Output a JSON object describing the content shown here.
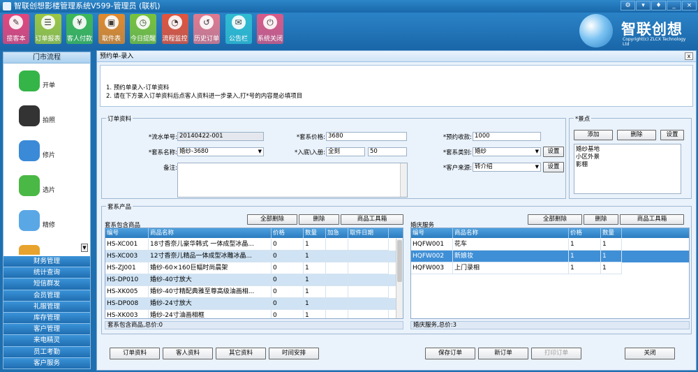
{
  "window": {
    "title": "智联创想影楼管理系统V599-管理员 (联机)"
  },
  "toolbar": [
    {
      "label": "揽客本",
      "color": "#e3457b"
    },
    {
      "label": "订单报表",
      "color": "#9bc742"
    },
    {
      "label": "客人付款",
      "color": "#3db858"
    },
    {
      "label": "取件表",
      "color": "#e28a2a"
    },
    {
      "label": "今日提醒",
      "color": "#78c23c"
    },
    {
      "label": "流程监控",
      "color": "#e2543c"
    },
    {
      "label": "历史订单",
      "color": "#e07a8e"
    },
    {
      "label": "公告栏",
      "color": "#2fbcd2"
    },
    {
      "label": "系统关闭",
      "color": "#d95a87"
    }
  ],
  "logo": {
    "name": "智联创想",
    "sub": "Copyright(c) ZLCX Technology Ltd"
  },
  "sidebar": {
    "title": "门市流程",
    "items": [
      {
        "label": "开单",
        "color": "#35b548"
      },
      {
        "label": "拍照",
        "color": "#333333"
      },
      {
        "label": "修片",
        "color": "#3a8ad8"
      },
      {
        "label": "选片",
        "color": "#4ab844"
      },
      {
        "label": "精修",
        "color": "#5aa7e6"
      }
    ],
    "menu": [
      "财务管理",
      "统计查询",
      "短信群发",
      "会员管理",
      "礼服管理",
      "库存管理",
      "客户管理",
      "来电精灵",
      "员工考勤",
      "客户服务"
    ]
  },
  "panel": {
    "title": "预约单-录入",
    "close": "x",
    "notes": [
      "1. 预约单录入-订单资料",
      "2. 请在下方录入订单资料后点客人资料进一步录入,打*号的内容是必填项目"
    ]
  },
  "order": {
    "group_label": "订单资料",
    "serial_label": "*流水单号:",
    "serial_value": "20140422-001",
    "package_name_label": "*套系名称:",
    "package_name_value": "婚纱-3680",
    "notes_label": "备注:",
    "price_label": "*套系价格:",
    "price_value": "3680",
    "base_label": "*入底\\入册:",
    "base_value": "全刻",
    "album_value": "50",
    "deposit_label": "*预约收款:",
    "deposit_value": "1000",
    "type_label": "*套系类别:",
    "type_value": "婚纱",
    "source_label": "*客户来源:",
    "source_value": "转介绍",
    "settings_label": "设置"
  },
  "scenes": {
    "group_label": "*景点",
    "add": "添加",
    "delete": "删除",
    "settings": "设置",
    "items": [
      "婚纱基地",
      "小区外景",
      "影棚"
    ]
  },
  "products": {
    "group_label": "套系产品",
    "left_title": "套系包含商品",
    "left_buttons": [
      "全部删除",
      "删除",
      "商品工具箱"
    ],
    "left_columns": [
      "编号",
      "商品名称",
      "价格",
      "数量",
      "加急",
      "取件日期"
    ],
    "left_rows": [
      [
        "HS-XC001",
        "18寸香奈儿豪华韩式 一体成型冰晶...",
        "0",
        "1",
        "",
        ""
      ],
      [
        "HS-XC003",
        "12寸香奈儿精品一体成型冰雕冰晶...",
        "0",
        "1",
        "",
        ""
      ],
      [
        "HS-ZJ001",
        "婚纱-60×160巨幅时尚晨架",
        "0",
        "1",
        "",
        ""
      ],
      [
        "HS-DP010",
        "婚纱-40寸放大",
        "0",
        "1",
        "",
        ""
      ],
      [
        "HS-XK005",
        "婚纱-40寸精配典雅至尊高级油画相...",
        "0",
        "1",
        "",
        ""
      ],
      [
        "HS-DP008",
        "婚纱-24寸放大",
        "0",
        "1",
        "",
        ""
      ],
      [
        "HS-XK003",
        "婚纱-24寸油画相框",
        "0",
        "1",
        "",
        ""
      ]
    ],
    "left_status": "套系包含商品,总价:0",
    "right_title": "婚庆服务",
    "right_buttons": [
      "全部删除",
      "删除",
      "商品工具箱"
    ],
    "right_columns": [
      "编号",
      "商品名称",
      "价格",
      "数量"
    ],
    "right_rows": [
      [
        "HQFW001",
        "花车",
        "1",
        "1"
      ],
      [
        "HQFW002",
        "新娘妆",
        "1",
        "1"
      ],
      [
        "HQFW003",
        "上门录相",
        "1",
        "1"
      ]
    ],
    "right_status": "婚庆服务,总价:3"
  },
  "bottom_buttons": {
    "order_info": "订单资料",
    "customer_info": "客人资料",
    "other_info": "其它资料",
    "schedule": "时间安排",
    "save": "保存订单",
    "new": "新订单",
    "print": "打印订单",
    "close": "关闭"
  }
}
